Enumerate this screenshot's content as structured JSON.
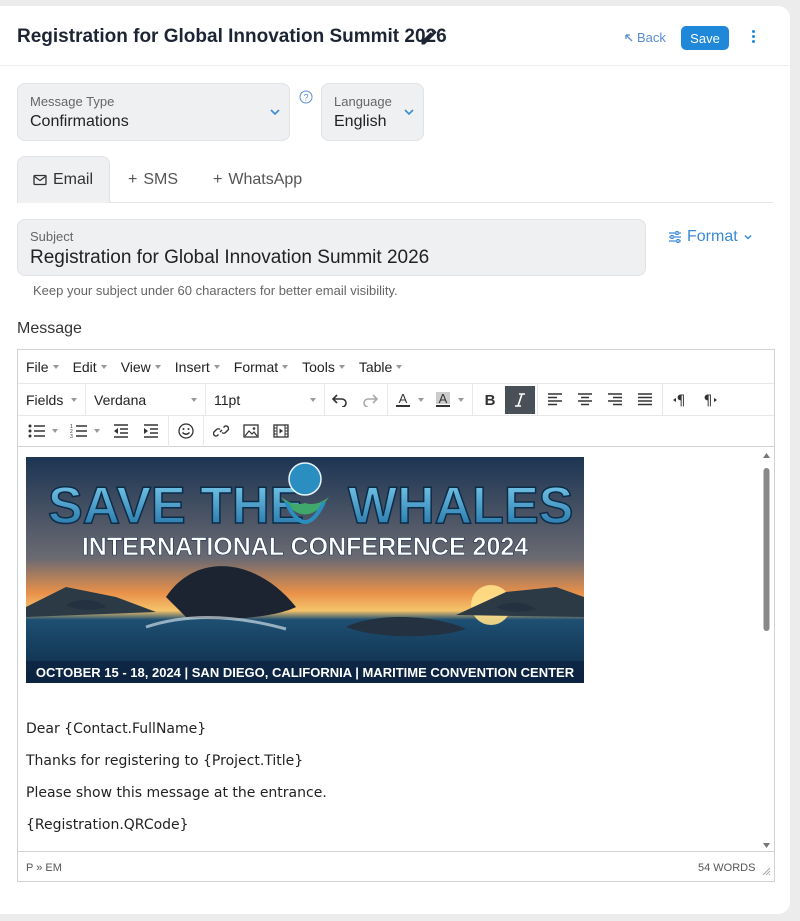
{
  "header": {
    "title": "Registration for Global Innovation Summit 2026",
    "back_label": "Back",
    "save_label": "Save"
  },
  "message_type": {
    "label": "Message Type",
    "value": "Confirmations"
  },
  "language": {
    "label": "Language",
    "value": "English"
  },
  "tabs": [
    {
      "label": "Email",
      "active": true
    },
    {
      "label": "SMS",
      "active": false
    },
    {
      "label": "WhatsApp",
      "active": false
    }
  ],
  "subject": {
    "label": "Subject",
    "value": "Registration for Global Innovation Summit 2026",
    "hint": "Keep your subject under 60 characters for better email visibility."
  },
  "format_label": "Format",
  "message_label": "Message",
  "editor": {
    "menus": [
      "File",
      "Edit",
      "View",
      "Insert",
      "Format",
      "Tools",
      "Table"
    ],
    "fields_label": "Fields",
    "font_family": "Verdana",
    "font_size": "11pt",
    "banner": {
      "title_left": "SAVE THE",
      "title_right": "WHALES",
      "subtitle": "INTERNATIONAL CONFERENCE 2024",
      "footer": "OCTOBER 15 - 18, 2024 | SAN DIEGO, CALIFORNIA | MARITIME CONVENTION CENTER"
    },
    "lines": [
      "Dear {Contact.FullName}",
      "Thanks for registering to {Project.Title}",
      "Please show this message at the entrance.",
      " {Registration.QRCode}"
    ],
    "status_path": "P » EM",
    "word_count": "54 WORDS"
  },
  "colors": {
    "accent": "#1f88d8",
    "link": "#3a8ad6",
    "field_bg": "#eef0f2"
  }
}
